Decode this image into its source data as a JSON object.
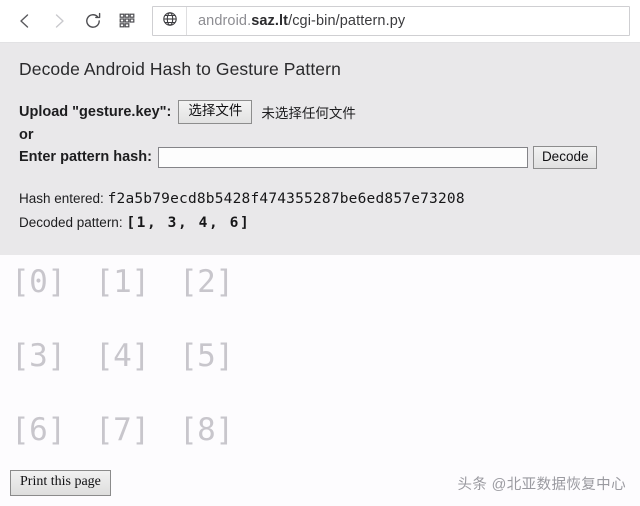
{
  "browser": {
    "back_icon": "chevron-left-icon",
    "forward_icon": "chevron-right-icon",
    "reload_icon": "reload-icon",
    "apps_icon": "grid-apps-icon",
    "site_icon": "globe-icon",
    "url_prefix": "android.",
    "url_host": "saz.lt",
    "url_path": "/cgi-bin/pattern.py",
    "url_full": "android.saz.lt/cgi-bin/pattern.py"
  },
  "page": {
    "title": "Decode Android Hash to Gesture Pattern",
    "upload_label": "Upload \"gesture.key\":",
    "file_button_label": "选择文件",
    "file_status": "未选择任何文件",
    "or_label": "or",
    "hash_label": "Enter pattern hash:",
    "hash_input_value": "",
    "hash_input_placeholder": "",
    "decode_button_label": "Decode",
    "hash_entered_label": "Hash entered:",
    "hash_entered_value": "f2a5b79ecd8b5428f474355287be6ed857e73208",
    "decoded_pattern_label": "Decoded pattern:",
    "decoded_pattern_value": "[1, 3, 4, 6]",
    "decoded_pattern_nodes": [
      1,
      3,
      4,
      6
    ]
  },
  "grid": {
    "rows": [
      [
        {
          "label": "[0]"
        },
        {
          "label": "[1]"
        },
        {
          "label": "[2]"
        }
      ],
      [
        {
          "label": "[3]"
        },
        {
          "label": "[4]"
        },
        {
          "label": "[5]"
        }
      ],
      [
        {
          "label": "[6]"
        },
        {
          "label": "[7]"
        },
        {
          "label": "[8]"
        }
      ]
    ]
  },
  "footer": {
    "print_button_label": "Print this page",
    "watermark": "头条 @北亚数据恢复中心"
  },
  "colors": {
    "panel_bg": "#e9e8ea",
    "page_bg": "#fdfcfe",
    "toolbar_bg": "#ffffff",
    "grid_text": "#c8c6cc",
    "text": "#1d1d1f",
    "watermark": "#9a9aa0"
  }
}
